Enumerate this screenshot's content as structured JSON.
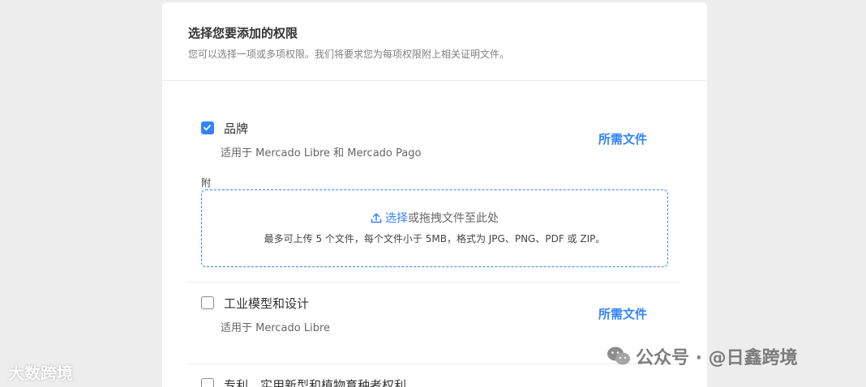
{
  "header": {
    "title": "选择您要添加的权限",
    "subtitle": "您可以选择一项或多项权限。我们将要求您为每项权限附上相关证明文件。"
  },
  "permissions": [
    {
      "name": "品牌",
      "applies_to": "适用于 Mercado Libre 和 Mercado Pago",
      "required_docs_label": "所需文件",
      "checked": true,
      "attachment": {
        "label": "附",
        "select_text": "选择",
        "drag_text": "或拖拽文件至此处",
        "limits": "最多可上传 5 个文件，每个文件小于 5MB，格式为 JPG、PNG、PDF 或 ZIP。"
      }
    },
    {
      "name": "工业模型和设计",
      "applies_to": "适用于 Mercado Libre",
      "required_docs_label": "所需文件",
      "checked": false
    },
    {
      "name": "专利、实用新型和植物育种者权利",
      "checked": false
    }
  ],
  "watermarks": {
    "left": "大数跨境",
    "right": "公众号 · @日鑫跨境"
  },
  "colors": {
    "accent": "#3483fa",
    "background": "#ededed",
    "card": "#ffffff"
  }
}
